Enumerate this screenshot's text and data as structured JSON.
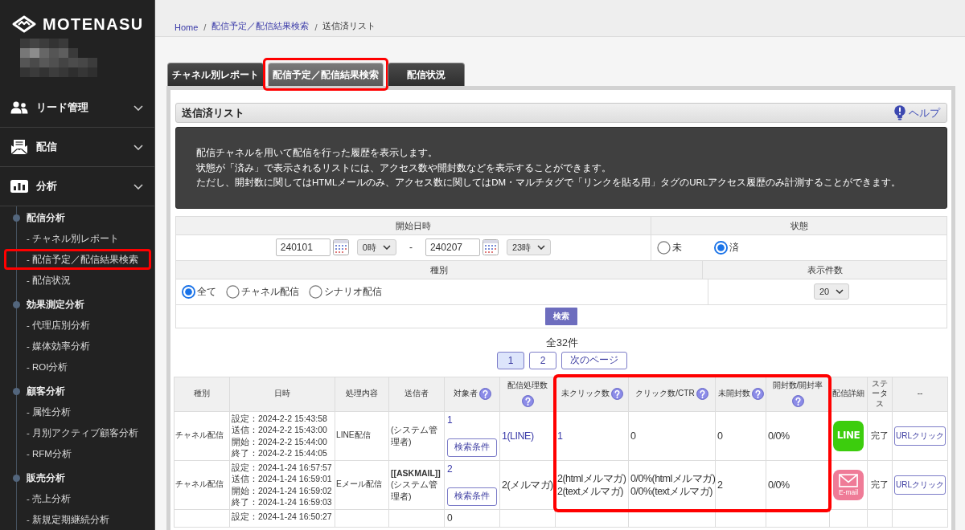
{
  "sidebar": {
    "logo": "MOTENASU",
    "sections": [
      {
        "label": "リード管理"
      },
      {
        "label": "配信"
      },
      {
        "label": "分析",
        "children": [
          {
            "label": "配信分析",
            "children": [
              {
                "label": "- チャネル別レポート",
                "highlighted": false
              },
              {
                "label": "- 配信予定／配信結果検索",
                "highlighted": true
              },
              {
                "label": "- 配信状況",
                "highlighted": false
              }
            ]
          },
          {
            "label": "効果測定分析",
            "children": [
              {
                "label": "- 代理店別分析",
                "highlighted": false
              },
              {
                "label": "- 媒体効率分析",
                "highlighted": false
              },
              {
                "label": "- ROI分析",
                "highlighted": false
              }
            ]
          },
          {
            "label": "顧客分析",
            "children": [
              {
                "label": "- 属性分析",
                "highlighted": false
              },
              {
                "label": "- 月別アクティブ顧客分析",
                "highlighted": false
              },
              {
                "label": "- RFM分析",
                "highlighted": false
              }
            ]
          },
          {
            "label": "販売分析",
            "children": [
              {
                "label": "- 売上分析",
                "highlighted": false
              },
              {
                "label": "- 新規定期継続分析",
                "highlighted": false
              }
            ]
          }
        ]
      }
    ]
  },
  "breadcrumb": {
    "separator": "/",
    "items": [
      {
        "label": "Home",
        "link": true
      },
      {
        "label": "配信予定／配信結果検索",
        "link": true
      },
      {
        "label": "送信済リスト",
        "link": false
      }
    ]
  },
  "tabs": [
    {
      "label": "チャネル別レポート",
      "selected": false,
      "highlighted": false
    },
    {
      "label": "配信予定／配信結果検索",
      "selected": true,
      "highlighted": true
    },
    {
      "label": "配信状況",
      "selected": false,
      "highlighted": false
    }
  ],
  "panel": {
    "title": "送信済リスト",
    "help": "ヘルプ",
    "info": [
      "配信チャネルを用いて配信を行った履歴を表示します。",
      "状態が「済み」で表示されるリストには、アクセス数や開封数などを表示することができます。",
      "ただし、開封数に関してはHTMLメールのみ、アクセス数に関してはDM・マルチタグで「リンクを貼る用」タグのURLアクセス履歴のみ計測することができます。"
    ]
  },
  "search_form": {
    "start": {
      "heading": "開始日時",
      "from_date": "240101",
      "from_hour": "0時",
      "dash": "-",
      "to_date": "240207",
      "to_hour": "23時"
    },
    "state": {
      "heading": "状態",
      "options": [
        {
          "label": "未",
          "selected": false
        },
        {
          "label": "済",
          "selected": true
        }
      ]
    },
    "type": {
      "heading": "種別",
      "options": [
        {
          "label": "全て",
          "selected": true
        },
        {
          "label": "チャネル配信",
          "selected": false
        },
        {
          "label": "シナリオ配信",
          "selected": false
        }
      ]
    },
    "page_size": {
      "heading": "表示件数",
      "value": "20"
    },
    "button": "検索"
  },
  "results": {
    "total": "全32件",
    "pages": [
      {
        "label": "1",
        "selected": true
      },
      {
        "label": "2",
        "selected": false
      },
      {
        "label": "次のページ",
        "selected": false
      }
    ]
  },
  "table": {
    "columns": [
      {
        "label": "種別",
        "help": false,
        "highlighted": false
      },
      {
        "label": "日時",
        "help": false,
        "highlighted": false
      },
      {
        "label": "処理内容",
        "help": false,
        "highlighted": false
      },
      {
        "label": "送信者",
        "help": false,
        "highlighted": false
      },
      {
        "label": "対象者",
        "help": true,
        "highlighted": false
      },
      {
        "label": "配信処理数",
        "help": true,
        "highlighted": false
      },
      {
        "label": "未クリック数",
        "help": true,
        "highlighted": true
      },
      {
        "label": "クリック数/CTR",
        "help": true,
        "highlighted": true
      },
      {
        "label": "未開封数",
        "help": true,
        "highlighted": true
      },
      {
        "label": "開封数/開封率",
        "help": true,
        "highlighted": true
      },
      {
        "label": "配信詳細",
        "help": false,
        "highlighted": false
      },
      {
        "label": "ステータス",
        "help": false,
        "highlighted": false
      },
      {
        "label": "--",
        "help": false,
        "highlighted": false
      }
    ],
    "rows": [
      {
        "type": "チャネル配信",
        "datetime": [
          "設定：2024-2-2 15:43:58",
          "送信：2024-2-2 15:43:00",
          "開始：2024-2-2 15:44:00",
          "終了：2024-2-2 15:44:05"
        ],
        "process": "LINE配信",
        "sender": [
          "(システム管理者)"
        ],
        "target": {
          "count": "1",
          "link": true,
          "button": "検索条件"
        },
        "sent": {
          "lines": [
            "1(LINE)"
          ],
          "link": true
        },
        "unclicked": {
          "lines": [
            "1"
          ],
          "link": true
        },
        "clicks": {
          "lines": [
            "0"
          ],
          "link": false
        },
        "unopened": {
          "lines": [
            "0"
          ],
          "link": false
        },
        "opened": {
          "lines": [
            "0/0%"
          ],
          "link": false
        },
        "detail": {
          "kind": "line",
          "label": "LINE"
        },
        "status": "完了",
        "action": "URLクリック"
      },
      {
        "type": "チャネル配信",
        "datetime": [
          "設定：2024-1-24 16:57:57",
          "送信：2024-1-24 16:59:01",
          "開始：2024-1-24 16:59:02",
          "終了：2024-1-24 16:59:03"
        ],
        "process": "Eメール配信",
        "sender": [
          "**[[ASKMAIL]]**",
          "(システム管理者)"
        ],
        "target": {
          "count": "2",
          "link": true,
          "button": "検索条件"
        },
        "sent": {
          "lines": [
            "2(メルマガ)"
          ],
          "link": false
        },
        "unclicked": {
          "lines": [
            "2(htmlメルマガ)",
            "2(textメルマガ)"
          ],
          "link": false
        },
        "clicks": {
          "lines": [
            "0/0%(htmlメルマガ)",
            "0/0%(textメルマガ)"
          ],
          "link": false
        },
        "unopened": {
          "lines": [
            "2"
          ],
          "link": false
        },
        "opened": {
          "lines": [
            "0/0%"
          ],
          "link": false
        },
        "detail": {
          "kind": "email",
          "label": "E-mail"
        },
        "status": "完了",
        "action": "URLクリック"
      }
    ],
    "cut_row": {
      "datetime": [
        "設定：2024-1-24 16:50:27"
      ],
      "target": {
        "count": "0",
        "link": false
      }
    }
  }
}
